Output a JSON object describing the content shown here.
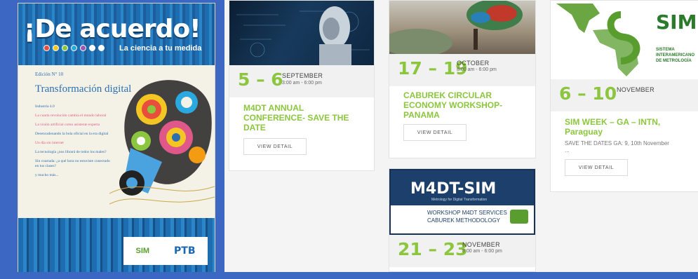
{
  "cover": {
    "title": "¡De acuerdo!",
    "subtitle": "La ciencia a tu medida",
    "edition": "Edición N° 10",
    "headline": "Transformación digital",
    "toc": [
      {
        "text": "Industria 4.0",
        "color": "#2c6fb0"
      },
      {
        "text": "La cuarta revolución cambia el mundo laboral",
        "color": "#e0588a"
      },
      {
        "text": "La visión artificial como asistente experta",
        "color": "#e0588a"
      },
      {
        "text": "Desencadenando la bola oficial en la era digital",
        "color": "#2c6fb0"
      },
      {
        "text": "Un día sin internet",
        "color": "#e0588a"
      },
      {
        "text": "La tecnología ¿nos librará de todos los males?",
        "color": "#2c6fb0"
      },
      {
        "text": "Sin coartada: ¿a qué hora no estuviste conectado en tus clases?",
        "color": "#2c6fb0"
      },
      {
        "text": "y mucho más...",
        "color": "#2c6fb0"
      }
    ],
    "dot_colors": [
      "#e94e3c",
      "#f3c623",
      "#8cc63f",
      "#2aa9e0",
      "#9b59b6",
      "#ffffff",
      "#ffffff"
    ],
    "logo_text": "PTB",
    "sim_logo": "SIM"
  },
  "events": [
    {
      "date_range": "5 – 6",
      "month": "SEPTEMBER",
      "time": "3:00 am - 6:00 pm",
      "title": "M4DT ANNUAL CONFERENCE- SAVE THE DATE",
      "button": "VIEW DETAIL"
    },
    {
      "date_range": "17 – 19",
      "month": "OCTOBER",
      "time": "8:00 am - 6:00 pm",
      "title": "CABUREK CIRCULAR ECONOMY WORKSHOP-PANAMA",
      "button": "VIEW DETAIL"
    },
    {
      "date_range": "21 – 23",
      "month": "NOVEMBER",
      "time": "8:00 am - 6:00 pm",
      "banner_title": "M4DT-SIM",
      "banner_sub": "Metrology for Digital Transformation",
      "banner_line1": "WORKSHOP M4DT SERVICES",
      "banner_line2": "CABUREK METHODOLOGY"
    },
    {
      "date_range": "6 – 10",
      "month": "NOVEMBER",
      "title": "SIM WEEK – GA – INTN, Paraguay",
      "description": "SAVE THE DATES GA: 9, 10th November",
      "ellipsis": "...",
      "button": "VIEW DETAIL",
      "logo_text": "SIM",
      "logo_sub1": "SISTEMA",
      "logo_sub2": "INTERAMERICANO",
      "logo_sub3": "DE METROLOGÍA"
    }
  ],
  "colors": {
    "accent_green": "#8cc63f",
    "frame_blue": "#3c68c4"
  }
}
